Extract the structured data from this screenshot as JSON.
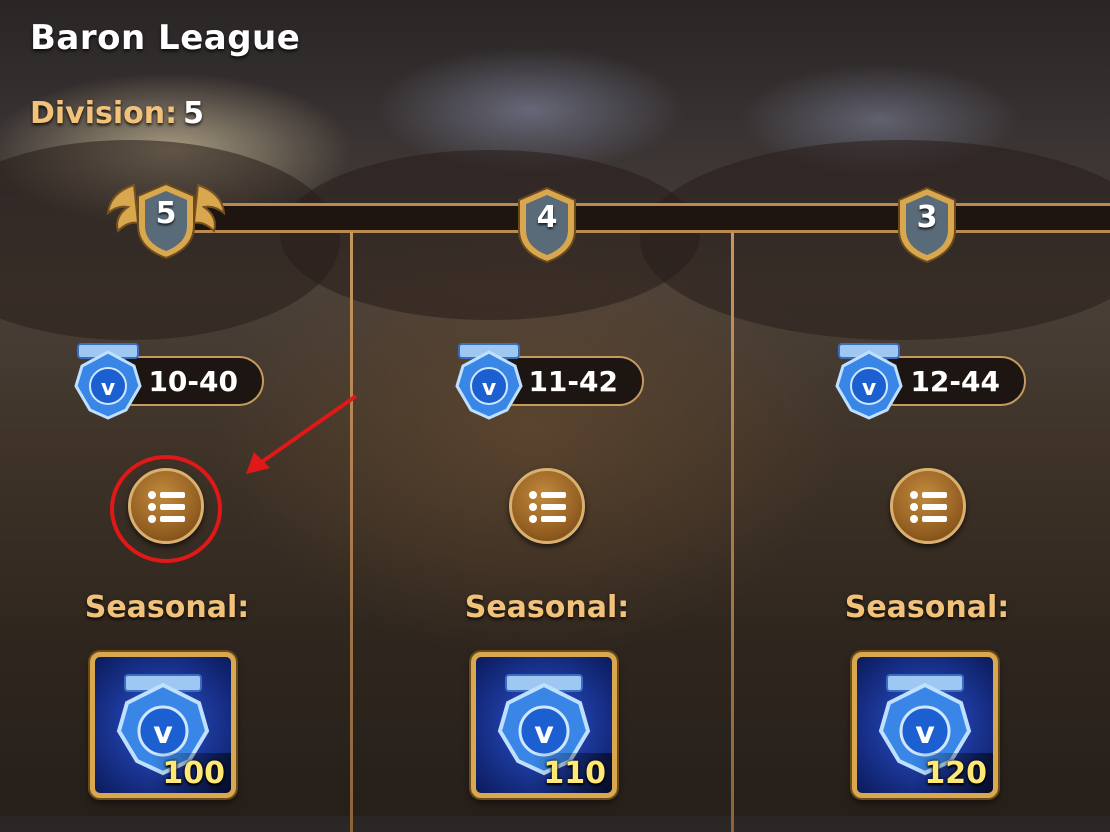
{
  "header": {
    "title": "Baron League",
    "division_label": "Division:",
    "division_value": "5"
  },
  "divisions": [
    {
      "number": "5",
      "range": "10-40",
      "seasonal_label": "Seasonal:",
      "reward_qty": "100",
      "current": true
    },
    {
      "number": "4",
      "range": "11-42",
      "seasonal_label": "Seasonal:",
      "reward_qty": "110",
      "current": false
    },
    {
      "number": "3",
      "range": "12-44",
      "seasonal_label": "Seasonal:",
      "reward_qty": "120",
      "current": false
    }
  ],
  "icons": {
    "badge": "shield-badge-icon",
    "currency": "valor-gem-icon",
    "details": "list-icon"
  },
  "colors": {
    "gold_label": "#f3c27a",
    "highlight": "#e01818",
    "qty": "#ffe873"
  }
}
